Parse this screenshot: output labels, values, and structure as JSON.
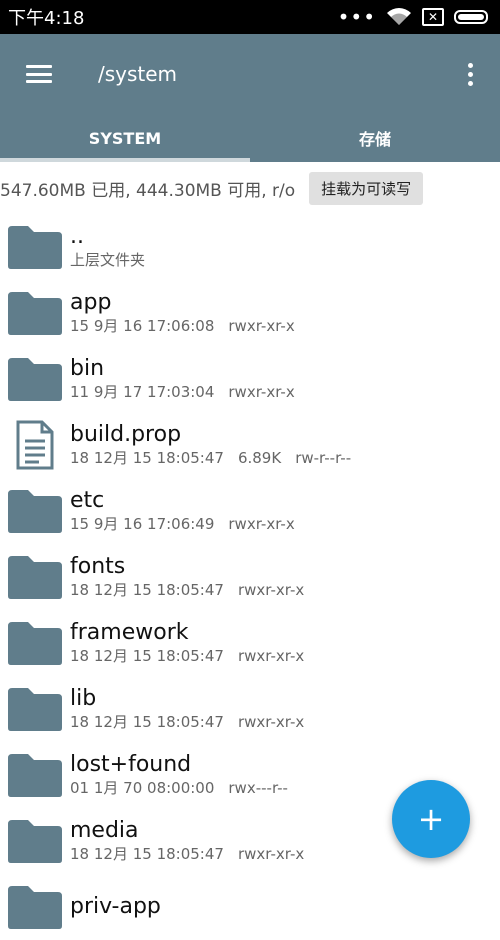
{
  "status": {
    "time": "下午4:18",
    "more_dots": "•••",
    "sim": "✕"
  },
  "appbar": {
    "path": "/system",
    "menu_icon": "hamburger-menu-icon",
    "overflow_icon": "more-vert-icon",
    "color": "#607d8b"
  },
  "tabs": [
    {
      "label": "SYSTEM",
      "active": true
    },
    {
      "label": "存储",
      "active": false
    }
  ],
  "storage": {
    "info": "547.60MB 已用, 444.30MB 可用, r/o",
    "mount_button": "挂载为可读写"
  },
  "files": [
    {
      "icon": "folder-icon",
      "name": "..",
      "date": "上层文件夹",
      "size": "",
      "perm": ""
    },
    {
      "icon": "folder-icon",
      "name": "app",
      "date": "15 9月 16 17:06:08",
      "size": "",
      "perm": "rwxr-xr-x"
    },
    {
      "icon": "folder-icon",
      "name": "bin",
      "date": "11 9月 17 17:03:04",
      "size": "",
      "perm": "rwxr-xr-x"
    },
    {
      "icon": "file-icon",
      "name": "build.prop",
      "date": "18 12月 15 18:05:47",
      "size": "6.89K",
      "perm": "rw-r--r--"
    },
    {
      "icon": "folder-icon",
      "name": "etc",
      "date": "15 9月 16 17:06:49",
      "size": "",
      "perm": "rwxr-xr-x"
    },
    {
      "icon": "folder-icon",
      "name": "fonts",
      "date": "18 12月 15 18:05:47",
      "size": "",
      "perm": "rwxr-xr-x"
    },
    {
      "icon": "folder-icon",
      "name": "framework",
      "date": "18 12月 15 18:05:47",
      "size": "",
      "perm": "rwxr-xr-x"
    },
    {
      "icon": "folder-icon",
      "name": "lib",
      "date": "18 12月 15 18:05:47",
      "size": "",
      "perm": "rwxr-xr-x"
    },
    {
      "icon": "folder-icon",
      "name": "lost+found",
      "date": "01 1月 70 08:00:00",
      "size": "",
      "perm": "rwx---r--"
    },
    {
      "icon": "folder-icon",
      "name": "media",
      "date": "18 12月 15 18:05:47",
      "size": "",
      "perm": "rwxr-xr-x"
    },
    {
      "icon": "folder-icon",
      "name": "priv-app",
      "date": "",
      "size": "",
      "perm": ""
    }
  ],
  "fab": {
    "label": "+",
    "icon": "add-icon",
    "color": "#1e9be0"
  }
}
